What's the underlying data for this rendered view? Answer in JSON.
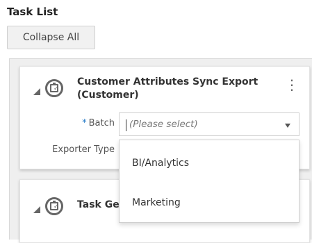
{
  "page": {
    "title": "Task List",
    "collapse_label": "Collapse All"
  },
  "cards": [
    {
      "title": "Customer Attributes Sync Export (Customer)",
      "fields": {
        "batch_label": "Batch",
        "batch_placeholder": "(Please select)",
        "exporter_label": "Exporter Type"
      }
    },
    {
      "title": "Task Ge"
    }
  ],
  "dropdown": {
    "options": [
      "BI/Analytics",
      "Marketing"
    ]
  },
  "icons": {
    "kebab": "more-vert-icon",
    "task": "task-clipboard-icon",
    "toggle": "collapse-triangle-icon",
    "caret": "chevron-down-icon"
  },
  "colors": {
    "required_star": "#1f77c7",
    "panel_bg": "#efefef"
  }
}
